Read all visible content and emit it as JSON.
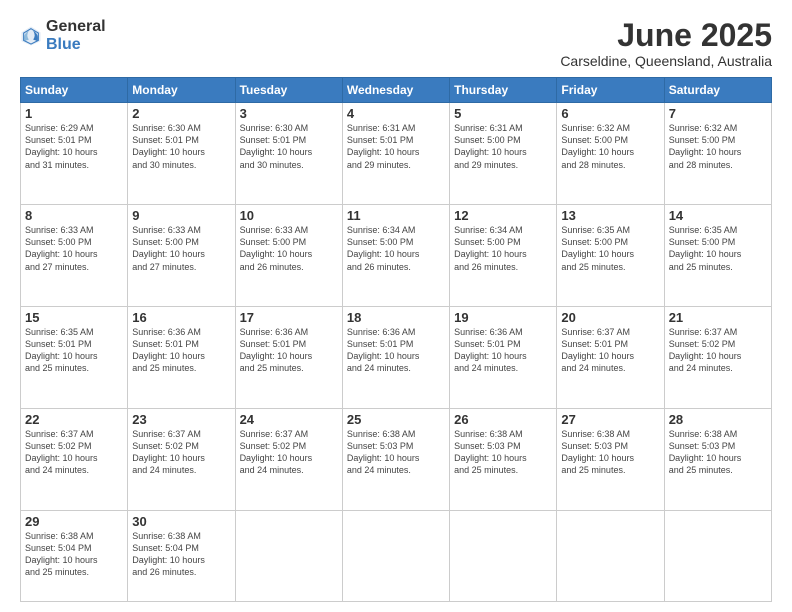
{
  "header": {
    "logo_general": "General",
    "logo_blue": "Blue",
    "month": "June 2025",
    "location": "Carseldine, Queensland, Australia"
  },
  "days_of_week": [
    "Sunday",
    "Monday",
    "Tuesday",
    "Wednesday",
    "Thursday",
    "Friday",
    "Saturday"
  ],
  "weeks": [
    [
      {
        "day": "1",
        "info": "Sunrise: 6:29 AM\nSunset: 5:01 PM\nDaylight: 10 hours\nand 31 minutes."
      },
      {
        "day": "2",
        "info": "Sunrise: 6:30 AM\nSunset: 5:01 PM\nDaylight: 10 hours\nand 30 minutes."
      },
      {
        "day": "3",
        "info": "Sunrise: 6:30 AM\nSunset: 5:01 PM\nDaylight: 10 hours\nand 30 minutes."
      },
      {
        "day": "4",
        "info": "Sunrise: 6:31 AM\nSunset: 5:01 PM\nDaylight: 10 hours\nand 29 minutes."
      },
      {
        "day": "5",
        "info": "Sunrise: 6:31 AM\nSunset: 5:00 PM\nDaylight: 10 hours\nand 29 minutes."
      },
      {
        "day": "6",
        "info": "Sunrise: 6:32 AM\nSunset: 5:00 PM\nDaylight: 10 hours\nand 28 minutes."
      },
      {
        "day": "7",
        "info": "Sunrise: 6:32 AM\nSunset: 5:00 PM\nDaylight: 10 hours\nand 28 minutes."
      }
    ],
    [
      {
        "day": "8",
        "info": "Sunrise: 6:33 AM\nSunset: 5:00 PM\nDaylight: 10 hours\nand 27 minutes."
      },
      {
        "day": "9",
        "info": "Sunrise: 6:33 AM\nSunset: 5:00 PM\nDaylight: 10 hours\nand 27 minutes."
      },
      {
        "day": "10",
        "info": "Sunrise: 6:33 AM\nSunset: 5:00 PM\nDaylight: 10 hours\nand 26 minutes."
      },
      {
        "day": "11",
        "info": "Sunrise: 6:34 AM\nSunset: 5:00 PM\nDaylight: 10 hours\nand 26 minutes."
      },
      {
        "day": "12",
        "info": "Sunrise: 6:34 AM\nSunset: 5:00 PM\nDaylight: 10 hours\nand 26 minutes."
      },
      {
        "day": "13",
        "info": "Sunrise: 6:35 AM\nSunset: 5:00 PM\nDaylight: 10 hours\nand 25 minutes."
      },
      {
        "day": "14",
        "info": "Sunrise: 6:35 AM\nSunset: 5:00 PM\nDaylight: 10 hours\nand 25 minutes."
      }
    ],
    [
      {
        "day": "15",
        "info": "Sunrise: 6:35 AM\nSunset: 5:01 PM\nDaylight: 10 hours\nand 25 minutes."
      },
      {
        "day": "16",
        "info": "Sunrise: 6:36 AM\nSunset: 5:01 PM\nDaylight: 10 hours\nand 25 minutes."
      },
      {
        "day": "17",
        "info": "Sunrise: 6:36 AM\nSunset: 5:01 PM\nDaylight: 10 hours\nand 25 minutes."
      },
      {
        "day": "18",
        "info": "Sunrise: 6:36 AM\nSunset: 5:01 PM\nDaylight: 10 hours\nand 24 minutes."
      },
      {
        "day": "19",
        "info": "Sunrise: 6:36 AM\nSunset: 5:01 PM\nDaylight: 10 hours\nand 24 minutes."
      },
      {
        "day": "20",
        "info": "Sunrise: 6:37 AM\nSunset: 5:01 PM\nDaylight: 10 hours\nand 24 minutes."
      },
      {
        "day": "21",
        "info": "Sunrise: 6:37 AM\nSunset: 5:02 PM\nDaylight: 10 hours\nand 24 minutes."
      }
    ],
    [
      {
        "day": "22",
        "info": "Sunrise: 6:37 AM\nSunset: 5:02 PM\nDaylight: 10 hours\nand 24 minutes."
      },
      {
        "day": "23",
        "info": "Sunrise: 6:37 AM\nSunset: 5:02 PM\nDaylight: 10 hours\nand 24 minutes."
      },
      {
        "day": "24",
        "info": "Sunrise: 6:37 AM\nSunset: 5:02 PM\nDaylight: 10 hours\nand 24 minutes."
      },
      {
        "day": "25",
        "info": "Sunrise: 6:38 AM\nSunset: 5:03 PM\nDaylight: 10 hours\nand 24 minutes."
      },
      {
        "day": "26",
        "info": "Sunrise: 6:38 AM\nSunset: 5:03 PM\nDaylight: 10 hours\nand 25 minutes."
      },
      {
        "day": "27",
        "info": "Sunrise: 6:38 AM\nSunset: 5:03 PM\nDaylight: 10 hours\nand 25 minutes."
      },
      {
        "day": "28",
        "info": "Sunrise: 6:38 AM\nSunset: 5:03 PM\nDaylight: 10 hours\nand 25 minutes."
      }
    ],
    [
      {
        "day": "29",
        "info": "Sunrise: 6:38 AM\nSunset: 5:04 PM\nDaylight: 10 hours\nand 25 minutes."
      },
      {
        "day": "30",
        "info": "Sunrise: 6:38 AM\nSunset: 5:04 PM\nDaylight: 10 hours\nand 26 minutes."
      },
      {
        "day": "",
        "info": ""
      },
      {
        "day": "",
        "info": ""
      },
      {
        "day": "",
        "info": ""
      },
      {
        "day": "",
        "info": ""
      },
      {
        "day": "",
        "info": ""
      }
    ]
  ]
}
